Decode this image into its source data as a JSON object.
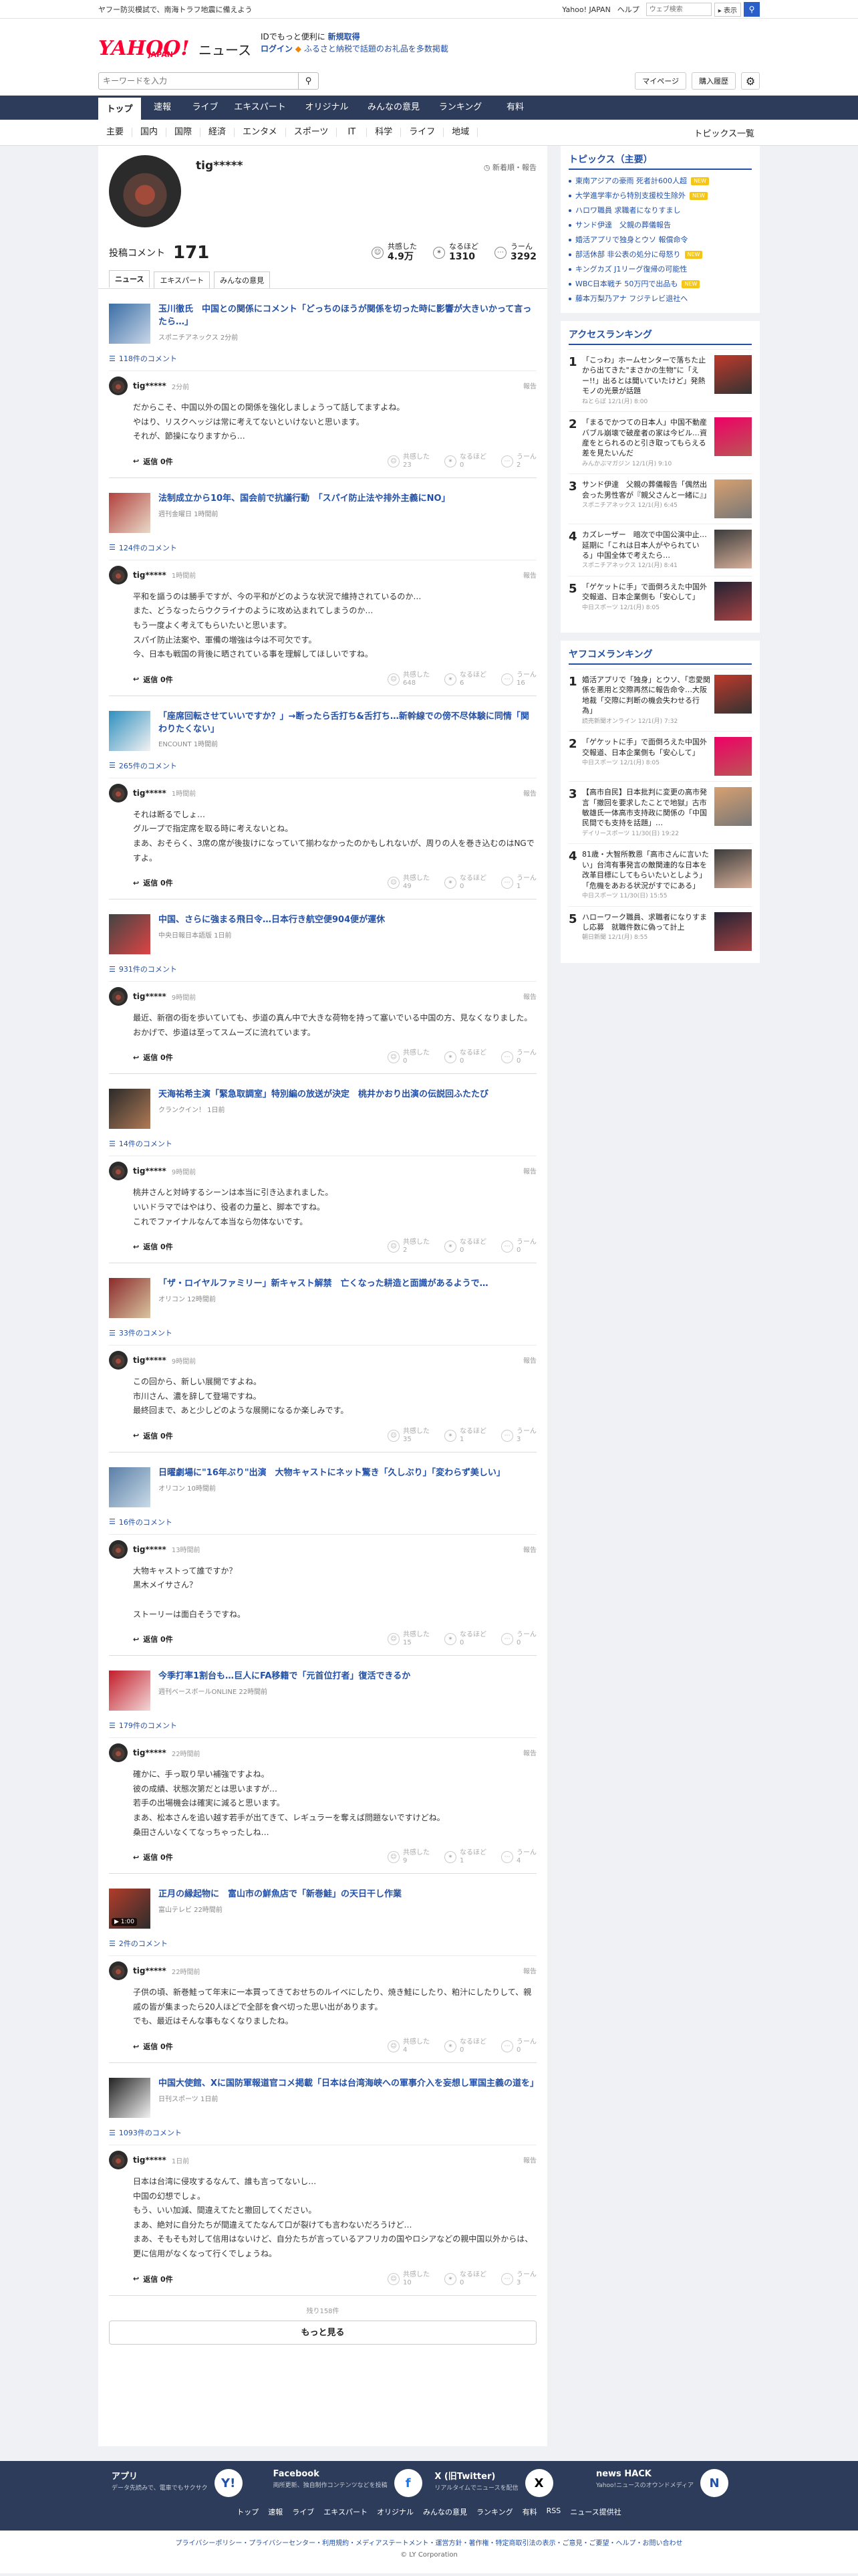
{
  "promo": {
    "left": "ヤフー防災模試で、南海トラフ地震に備えよう",
    "links": [
      "Yahoo! JAPAN",
      "ヘルプ"
    ],
    "search_placeholder": "ウェブ検索",
    "search_btn": "▸ 表示",
    "search_icon": "search-icon"
  },
  "brand": {
    "logo": "YAHOO!",
    "logo_jp": "JAPAN",
    "logo_news": "ニュース",
    "msg1": "IDでもっと便利に",
    "msg1b": "新規取得",
    "msg2": "ログイン",
    "msg2b": "ふるさと納税で話題のお礼品を多数掲載"
  },
  "search": {
    "placeholder": "キーワードを入力",
    "mypage": "マイページ",
    "purchase": "購入履歴"
  },
  "gnav": [
    "トップ",
    "速報",
    "ライブ",
    "エキスパート",
    "オリジナル",
    "みんなの意見",
    "ランキング",
    "有料"
  ],
  "cnav": [
    "主要",
    "国内",
    "国際",
    "経済",
    "エンタメ",
    "スポーツ",
    "IT",
    "科学",
    "ライフ",
    "地域"
  ],
  "cnav_right": "トピックス一覧",
  "profile": {
    "name": "tig*****",
    "badge": "新着順・報告",
    "stat_label": "投稿コメント",
    "stat_count": "171",
    "stats": [
      {
        "label": "共感した",
        "value": "4.9万"
      },
      {
        "label": "なるほど",
        "value": "1310"
      },
      {
        "label": "うーん",
        "value": "3292"
      }
    ]
  },
  "tabs": [
    "ニュース",
    "エキスパート",
    "みんなの意見"
  ],
  "items": [
    {
      "title": "玉川徹氏　中国との関係にコメント「どっちのほうが関係を切った時に影響が大きいかって言ったら…」",
      "src": "スポニチアネックス 2分前",
      "ccount": "118件のコメント",
      "time": "2分前",
      "body": "だからこそ、中国以外の国との関係を強化しましょうって話してますよね。\nやはり、リスクヘッジは常に考えてないといけないと思います。\nそれが、節操になりますから…",
      "r": [
        "23",
        "0",
        "2"
      ]
    },
    {
      "title": "法制成立から10年、国会前で抗議行動　「スパイ防止法や排外主義にNO」",
      "src": "週刊金曜日 1時間前",
      "ccount": "124件のコメント",
      "time": "1時間前",
      "body": "平和を謳うのは勝手ですが、今の平和がどのような状況で維持されているのか…\nまた、どうなったらウクライナのように攻め込まれてしまうのか…\nもう一度よく考えてもらいたいと思います。\nスパイ防止法案や、軍備の増強は今は不可欠です。\n今、日本も戦国の背後に晒されている事を理解してほしいですね。",
      "r": [
        "648",
        "6",
        "16"
      ]
    },
    {
      "title": "「座席回転させていいですか？」→断ったら舌打ち&舌打ち…新幹線での傍不尽体験に同情「関わりたくない」",
      "src": "ENCOUNT 1時間前",
      "ccount": "265件のコメント",
      "time": "1時間前",
      "body": "それは断るでしょ…\nグループで指定席を取る時に考えないとね。\nまあ、おそらく、3席の席が後抜けになっていて揃わなかったのかもしれないが、周りの人を巻き込むのはNGですよ。",
      "r": [
        "49",
        "0",
        "1"
      ]
    },
    {
      "title": "中国、さらに強まる飛日令…日本行き航空便904便が運休",
      "src": "中央日報日本語版 1日前",
      "ccount": "931件のコメント",
      "time": "9時間前",
      "body": "最近、新宿の街を歩いていても、歩道の真ん中で大きな荷物を持って塞いでいる中国の方、見なくなりました。\nおかげで、歩道は至ってスムーズに流れています。",
      "r": [
        "0",
        "0",
        "0"
      ]
    },
    {
      "title": "天海祐希主演「緊急取調室」特別編の放送が決定　桃井かおり出演の伝説回ふたたび",
      "src": "クランクイン！ 1日前",
      "ccount": "14件のコメント",
      "time": "9時間前",
      "body": "桃井さんと対峙するシーンは本当に引き込まれました。\nいいドラマではやはり、役者の力量と、脚本ですね。\nこれでファイナルなんて本当なら勿体ないです。",
      "r": [
        "2",
        "0",
        "0"
      ]
    },
    {
      "title": "「ザ・ロイヤルファミリー」新キャスト解禁　亡くなった耕造と面識があるようで…",
      "src": "オリコン 12時間前",
      "ccount": "33件のコメント",
      "time": "9時間前",
      "body": "この回から、新しい展開ですよね。\n市川さん、濃を辞して登場ですね。\n最終回まで、あと少しどのような展開になるか楽しみです。",
      "r": [
        "35",
        "1",
        "3"
      ]
    },
    {
      "title": "日曜劇場に\"16年ぶり\"出演　大物キャストにネット驚き「久しぶり」「変わらず美しい」",
      "src": "オリコン 10時間前",
      "ccount": "16件のコメント",
      "time": "13時間前",
      "body": "大物キャストって誰ですか？\n黒木メイサさん？\n\nストーリーは面白そうですね。",
      "r": [
        "15",
        "0",
        "0"
      ]
    },
    {
      "title": "今季打率1割台も…巨人にFA移籍で「元首位打者」復活できるか",
      "src": "週刊ベースボールONLINE 22時間前",
      "ccount": "179件のコメント",
      "time": "22時間前",
      "body": "確かに、手っ取り早い補強ですよね。\n彼の成績、状態次第だとは思いますが…\n若手の出場機会は確実に減ると思います。\nまあ、松本さんを追い越す若手が出てきて、レギュラーを奪えば問題ないですけどね。\n桑田さんいなくてなっちゃったしね…",
      "r": [
        "9",
        "1",
        "4"
      ]
    },
    {
      "title": "正月の縁起物に　富山市の鮮魚店で「新巻鮭」の天日干し作業",
      "src": "富山テレビ 22時間前",
      "ccount": "2件のコメント",
      "time": "22時間前",
      "body": "子供の頃、新巻鮭って年末に一本買ってきておせちのルイベにしたり、焼き鮭にしたり、粕汁にしたりして、親戚の皆が集まったら20人ほどで全部を食べ切った思い出があります。\nでも、最近はそんな事もなくなりましたね。",
      "r": [
        "4",
        "0",
        "0"
      ]
    },
    {
      "title": "中国大使館、Xに国防軍報道官コメ掲載「日本は台湾海峡への軍事介入を妄想し軍国主義の道を」",
      "src": "日刊スポーツ 1日前",
      "ccount": "1093件のコメント",
      "time": "1日前",
      "body": "日本は台湾に侵攻するなんて、誰も言ってないし…\n中国の幻想でしょ。\nもう、いい加減、間違えてたと撤回してください。\nまあ、絶対に自分たちが間違えてたなんて口が裂けても言わないだろうけど…\nまあ、そもそも対して信用はないけど、自分たちが言っているアフリカの国やロシアなどの親中国以外からは、更に信用がなくなって行くでしょうね。",
      "r": [
        "10",
        "0",
        "3"
      ]
    }
  ],
  "reply": "返信 0件",
  "react_labels": [
    "共感した",
    "なるほど",
    "うーん"
  ],
  "report": "報告",
  "more": {
    "count": "残り158件",
    "btn": "もっと見る"
  },
  "side": {
    "topics_h": "トピックス（主要）",
    "topics": [
      {
        "t": "東南アジアの豪雨 死者計600人超",
        "n": true
      },
      {
        "t": "大学進学率から特別支援校生除外",
        "n": true
      },
      {
        "t": "ハロワ職員 求職者になりすまし",
        "n": false
      },
      {
        "t": "サンド伊達　父親の葬儀報告",
        "n": false
      },
      {
        "t": "婚活アプリで独身とウソ 報償命令",
        "n": false
      },
      {
        "t": "部活休部 非公表の処分に母怒り",
        "n": true
      },
      {
        "t": "キングカズ J1リーグ復帰の可能性",
        "n": false
      },
      {
        "t": "WBC日本戦チ 50万円で出品も",
        "n": true
      },
      {
        "t": "藤本万梨乃アナ フジテレビ退社へ",
        "n": false
      }
    ],
    "access_h": "アクセスランキング",
    "access": [
      {
        "t": "「こっわ」ホームセンターで落ちた止から出てきた\"まさかの生物\"に「えー!!」出るとは聞いていたけど」発熱モノの光景が話題",
        "s": "ねとらぼ 12/1(月) 8:00"
      },
      {
        "t": "「まるでかつての日本人」中国不動産バブル崩壊で破産者の家は今ビル…資産をとられるのと引き取ってもらえる差を見たいんだ",
        "s": "みんかぶマガジン 12/1(月) 9:10"
      },
      {
        "t": "サンド伊達　父親の葬儀報告「偶然出会った男性客が『親父さんと一緒に』」",
        "s": "スポニチアネックス 12/1(月) 6:45"
      },
      {
        "t": "カズレーザー　暗次で中国公演中止…延期に「これは日本人がやられている」中国全体で考えたら…",
        "s": "スポニチアネックス 12/1(月) 8:41"
      },
      {
        "t": "「ゲケットに手」で面倒ろえた中国外交報道、日本企業側も「安心して」",
        "s": "中日スポーツ 12/1(月) 8:05"
      }
    ],
    "yahoo_h": "ヤフコメランキング",
    "yahoo": [
      {
        "t": "婚活アプリで「独身」とウソ、「恋愛関係を悪用と交際再然に報告命令…大阪地裁「交際に判断の機会失わせる行為」",
        "s": "読売新聞オンライン 12/1(月) 7:32"
      },
      {
        "t": "「ゲケットに手」で面倒ろえた中国外交報道、日本企業側も「安心して」",
        "s": "中日スポーツ 12/1(月) 8:05"
      },
      {
        "t": "【高市自民】日本批判に変更の高市発言「撤回を要求したことで地獄」古市敏雄氏一体高市支持政に関係の「中国民間でも支持を話題」…",
        "s": "デイリースポーツ 11/30(日) 19:22"
      },
      {
        "t": "81歳・大智所教恩「高市さんに言いたい」台湾有事発言の敵関連的な日本を改革目標にしてもらいたいとしよう」「危機をあおる状況がすでにある」",
        "s": "中日スポーツ 11/30(日) 15:55"
      },
      {
        "t": "ハローワーク職員、求職者になりすまし応募　就職件数に偽って計上",
        "s": "朝日新聞 12/1(月) 8:55"
      }
    ]
  },
  "footer": {
    "apps": [
      {
        "t": "アプリ",
        "d": "データ先読みで、電車でもサクサク",
        "icon": "app-icon"
      },
      {
        "t": "Facebook",
        "d": "両所更新、独自制作コンテンツなどを投稿",
        "icon": "facebook-icon"
      },
      {
        "t": "X (旧Twitter)",
        "d": "リアルタイムでニュースを配信",
        "icon": "x-icon"
      },
      {
        "t": "news HACK",
        "d": "Yahoo!ニュースのオウンドメディア",
        "icon": "news-hack-icon"
      }
    ],
    "nav": [
      "トップ",
      "速報",
      "ライブ",
      "エキスパート",
      "オリジナル",
      "みんなの意見",
      "ランキング",
      "有料",
      "RSS",
      "ニュース提供社"
    ],
    "legal": "プライバシーポリシー・プライバシーセンター・利用規約・メディアステートメント・運営方針・著作権・特定商取引法の表示・ご意見・ご要望・ヘルプ・お問い合わせ",
    "copy": "© LY Corporation"
  }
}
